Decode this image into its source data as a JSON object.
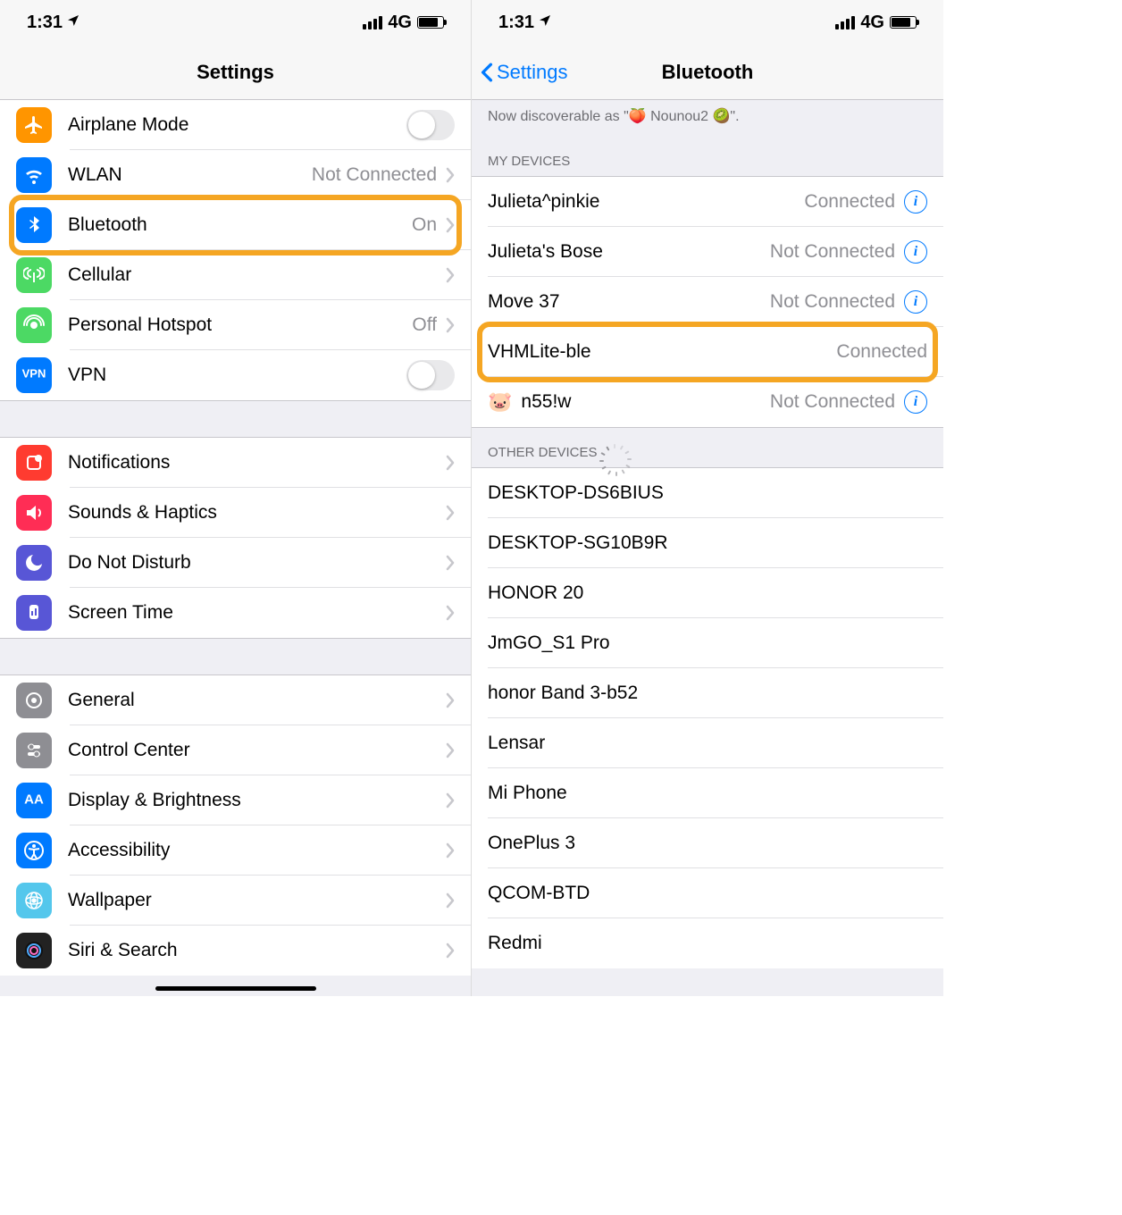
{
  "statusBar": {
    "time": "1:31",
    "network": "4G"
  },
  "left": {
    "title": "Settings",
    "groups": [
      {
        "rows": [
          {
            "icon": "airplane",
            "color": "#ff9500",
            "label": "Airplane Mode",
            "type": "toggle",
            "value": ""
          },
          {
            "icon": "wifi",
            "color": "#007aff",
            "label": "WLAN",
            "type": "link",
            "value": "Not Connected"
          },
          {
            "icon": "bluetooth",
            "color": "#007aff",
            "label": "Bluetooth",
            "type": "link",
            "value": "On",
            "highlight": true
          },
          {
            "icon": "cellular",
            "color": "#4cd964",
            "label": "Cellular",
            "type": "link",
            "value": ""
          },
          {
            "icon": "hotspot",
            "color": "#4cd964",
            "label": "Personal Hotspot",
            "type": "link",
            "value": "Off"
          },
          {
            "icon": "vpn",
            "color": "#007aff",
            "label": "VPN",
            "type": "toggle",
            "value": ""
          }
        ]
      },
      {
        "rows": [
          {
            "icon": "notifications",
            "color": "#ff3b30",
            "label": "Notifications",
            "type": "link",
            "value": ""
          },
          {
            "icon": "sounds",
            "color": "#ff2d55",
            "label": "Sounds & Haptics",
            "type": "link",
            "value": ""
          },
          {
            "icon": "dnd",
            "color": "#5856d6",
            "label": "Do Not Disturb",
            "type": "link",
            "value": ""
          },
          {
            "icon": "screentime",
            "color": "#5856d6",
            "label": "Screen Time",
            "type": "link",
            "value": ""
          }
        ]
      },
      {
        "rows": [
          {
            "icon": "general",
            "color": "#8e8e93",
            "label": "General",
            "type": "link",
            "value": ""
          },
          {
            "icon": "control",
            "color": "#8e8e93",
            "label": "Control Center",
            "type": "link",
            "value": ""
          },
          {
            "icon": "display",
            "color": "#007aff",
            "label": "Display & Brightness",
            "type": "link",
            "value": ""
          },
          {
            "icon": "accessibility",
            "color": "#007aff",
            "label": "Accessibility",
            "type": "link",
            "value": ""
          },
          {
            "icon": "wallpaper",
            "color": "#54c7ec",
            "label": "Wallpaper",
            "type": "link",
            "value": ""
          },
          {
            "icon": "siri",
            "color": "#222",
            "label": "Siri & Search",
            "type": "link",
            "value": ""
          }
        ]
      }
    ]
  },
  "right": {
    "back": "Settings",
    "title": "Bluetooth",
    "discoverable": "Now discoverable as \"🍑 Nounou2 🥝\".",
    "myDevicesHeader": "MY DEVICES",
    "myDevices": [
      {
        "name": "Julieta^pinkie",
        "status": "Connected",
        "info": true
      },
      {
        "name": "Julieta's Bose",
        "status": "Not Connected",
        "info": true
      },
      {
        "name": "Move 37",
        "status": "Not Connected",
        "info": true
      },
      {
        "name": "VHMLite-ble",
        "status": "Connected",
        "info": false,
        "highlight": true
      },
      {
        "name": "n55!w",
        "status": "Not Connected",
        "info": true,
        "emoji": "🐷"
      }
    ],
    "otherDevicesHeader": "OTHER DEVICES",
    "otherDevices": [
      {
        "name": "DESKTOP-DS6BIUS"
      },
      {
        "name": "DESKTOP-SG10B9R"
      },
      {
        "name": "HONOR 20"
      },
      {
        "name": "JmGO_S1 Pro"
      },
      {
        "name": "honor Band 3-b52"
      },
      {
        "name": "Lensar"
      },
      {
        "name": "Mi Phone"
      },
      {
        "name": "OnePlus 3"
      },
      {
        "name": "QCOM-BTD"
      },
      {
        "name": "Redmi"
      }
    ]
  }
}
